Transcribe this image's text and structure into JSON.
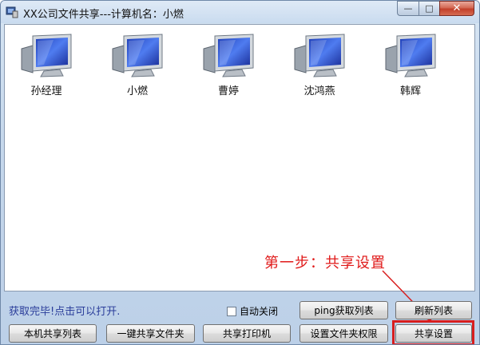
{
  "window": {
    "title": "XX公司文件共享---计算机名：小燃",
    "minimize_glyph": "—",
    "maximize_glyph": "□",
    "close_glyph": "✕"
  },
  "computers": [
    {
      "label": "孙经理"
    },
    {
      "label": "小燃"
    },
    {
      "label": "曹婷"
    },
    {
      "label": "沈鸿燕"
    },
    {
      "label": "韩辉"
    }
  ],
  "annotation": {
    "text": "第一步：共享设置",
    "color": "#e01a1a"
  },
  "status": {
    "text": "获取完毕!点击可以打开.",
    "color": "#2a3d9a"
  },
  "auto_close": {
    "label": "自动关闭",
    "checked": false
  },
  "buttons": {
    "ping_list": "ping获取列表",
    "refresh_list": "刷新列表",
    "local_share_list": "本机共享列表",
    "one_click_share": "一键共享文件夹",
    "share_printer": "共享打印机",
    "folder_permissions": "设置文件夹权限",
    "share_settings": "共享设置"
  },
  "icons": {
    "app": "app-icon",
    "computer": "computer-monitor-icon"
  }
}
